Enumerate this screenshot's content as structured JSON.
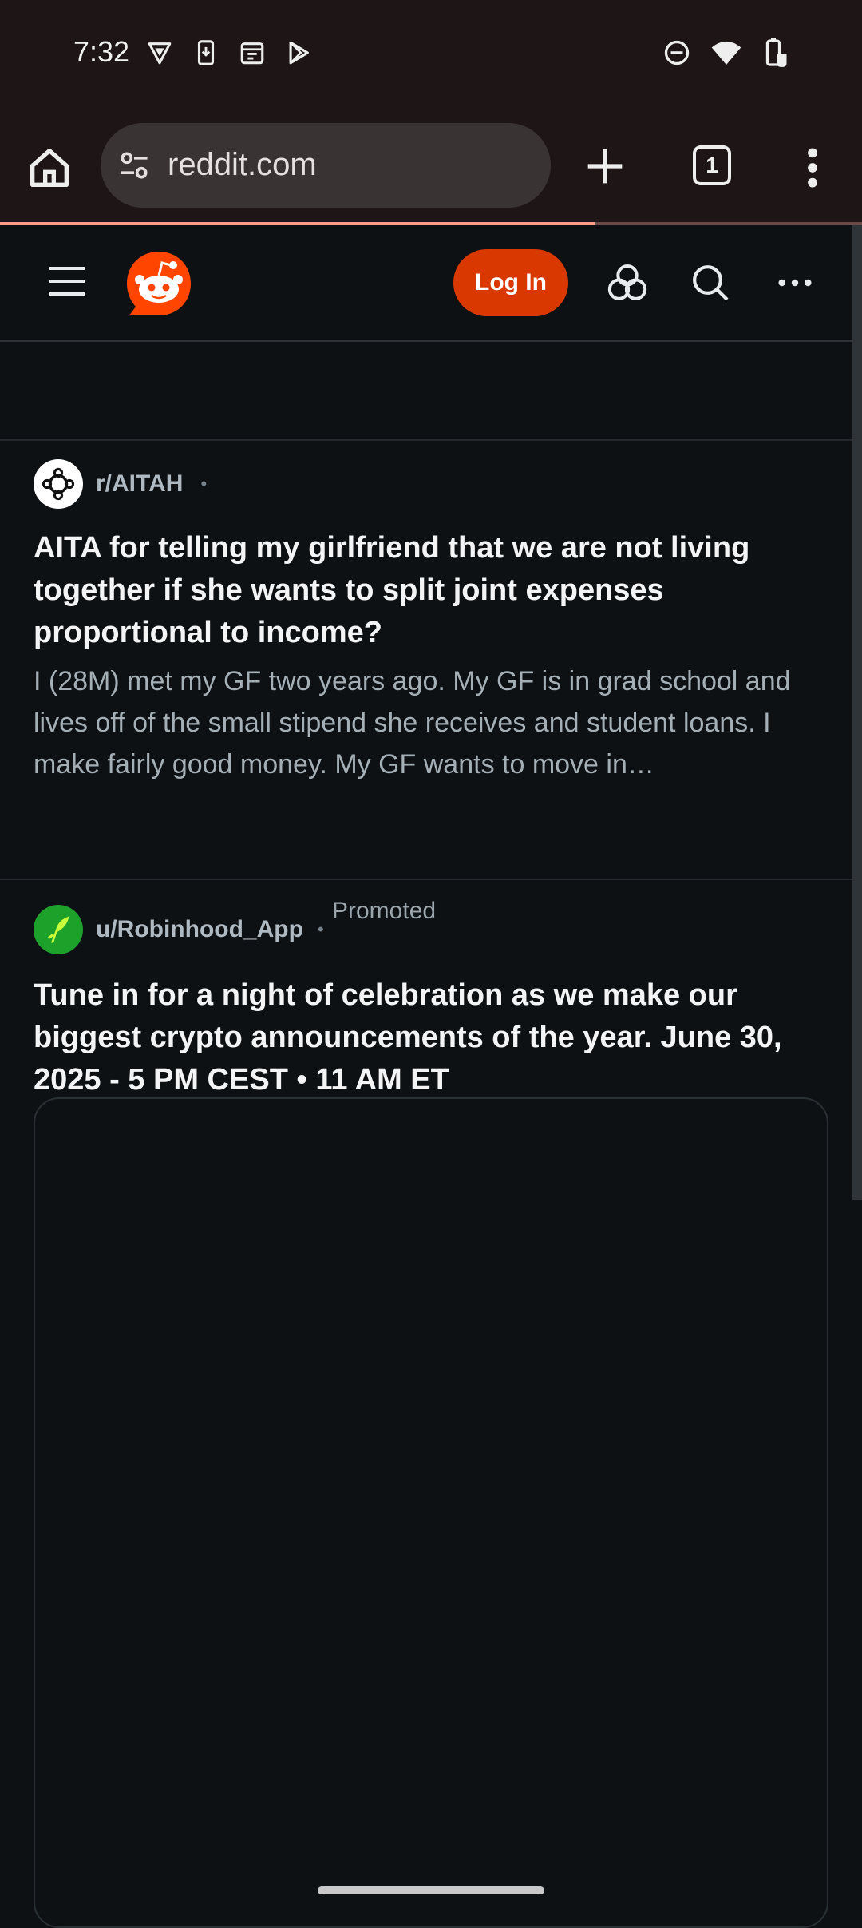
{
  "status_bar": {
    "time": "7:32",
    "left_icons": [
      "vpn-shield-icon",
      "download-phone-icon",
      "calendar-icon",
      "play-store-icon"
    ],
    "right_icons": [
      "do-not-disturb-icon",
      "wifi-icon",
      "battery-saver-icon"
    ]
  },
  "browser": {
    "url": "reddit.com",
    "tab_count": "1",
    "load_progress": 0.69,
    "icons": [
      "home-icon",
      "site-settings-icon",
      "new-tab-icon",
      "tab-switcher-icon",
      "more-menu-icon"
    ]
  },
  "header": {
    "login_label": "Log In",
    "icons": [
      "hamburger-icon",
      "reddit-logo",
      "communities-icon",
      "search-icon",
      "more-options-icon"
    ]
  },
  "posts": [
    {
      "subreddit": "r/AITAH",
      "separator": "•",
      "title": "AITA for telling my girlfriend that we are not living together if she wants to split joint expenses proportional to income?",
      "body": "I (28M) met my GF two years ago. My GF is in grad school and lives off of the small stipend she receives and student loans. I make fairly good money. My GF wants to move in…"
    },
    {
      "author": "u/Robinhood_App",
      "separator": "•",
      "badge": "Promoted",
      "title": "Tune in for a night of celebration as we make our biggest crypto announcements of the year. June 30, 2025 - 5 PM CEST • 11 AM ET"
    }
  ],
  "colors": {
    "background": "#0e1113",
    "chrome": "#1e1516",
    "login_button": "#d93900",
    "reddit_orange": "#ff4500",
    "robinhood_green": "#1ea12a"
  }
}
